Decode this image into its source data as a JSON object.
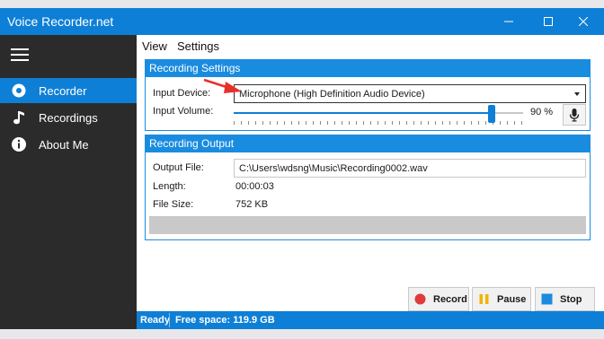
{
  "window": {
    "title": "Voice Recorder.net",
    "controls": [
      "minimize-icon",
      "maximize-icon",
      "close-icon"
    ]
  },
  "sidebar": {
    "menu_icon": "hamburger-icon",
    "items": [
      {
        "label": "Recorder",
        "icon": "record-dot-icon",
        "active": true
      },
      {
        "label": "Recordings",
        "icon": "music-note-icon",
        "active": false
      },
      {
        "label": "About Me",
        "icon": "info-icon",
        "active": false
      }
    ]
  },
  "menubar": {
    "view": "View",
    "settings": "Settings"
  },
  "recording_settings": {
    "title": "Recording Settings",
    "input_device_label": "Input Device:",
    "input_device_value": "Microphone (High Definition Audio Device)",
    "input_volume_label": "Input Volume:",
    "volume_percent": 90,
    "volume_text": "90 %",
    "mic_icon": "microphone-icon"
  },
  "recording_output": {
    "title": "Recording Output",
    "output_file_label": "Output File:",
    "output_file_value": "C:\\Users\\wdsng\\Music\\Recording0002.wav",
    "length_label": "Length:",
    "length_value": "00:00:03",
    "file_size_label": "File Size:",
    "file_size_value": "752 KB",
    "progress_fraction": 0.0
  },
  "actions": {
    "record": "Record",
    "pause": "Pause",
    "stop": "Stop"
  },
  "status": {
    "ready": "Ready",
    "free_space": "Free space: 119.9 GB"
  },
  "colors": {
    "accent": "#0e7fd6",
    "sidebar_bg": "#2b2b2b",
    "record_red": "#e03a3a",
    "pause_yellow": "#f0b400",
    "stop_blue": "#1a8ce0",
    "annotation_red": "#e8302a"
  }
}
